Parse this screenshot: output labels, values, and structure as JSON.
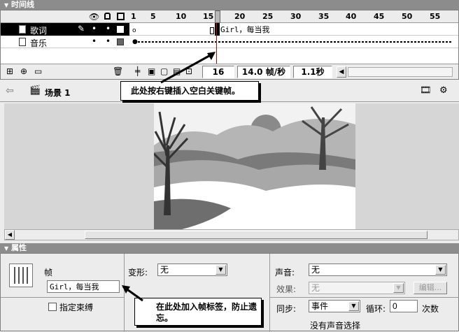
{
  "timeline": {
    "title": "时间线",
    "ruler": [
      "1",
      "5",
      "10",
      "15",
      "20",
      "25",
      "30",
      "35",
      "40",
      "45",
      "50",
      "55"
    ],
    "layers": [
      {
        "name": "歌词",
        "selected": true
      },
      {
        "name": "音乐",
        "selected": false
      }
    ],
    "frame_label": "Girl，每当我",
    "status": {
      "frame": "16",
      "fps": "14.0 帧/秒",
      "time": "1.1秒"
    }
  },
  "stage": {
    "scene": "场景 1"
  },
  "callout1": "此处按右键插入空白关键帧。",
  "callout2": "在此处加入帧标签，防止遗忘。",
  "properties": {
    "title": "属性",
    "frame_heading": "帧",
    "frame_label_value": "Girl，每当我",
    "checkbox_label": "指定束缚",
    "tween_label": "变形:",
    "tween_value": "无",
    "sound_label": "声音:",
    "sound_value": "无",
    "effect_label": "效果:",
    "effect_value": "无",
    "edit_button": "编辑...",
    "sync_label": "同步:",
    "sync_value": "事件",
    "loop_label": "循环:",
    "loop_value": "0",
    "loop_unit": "次数",
    "no_sound": "没有声音选择"
  },
  "colors": {
    "panel_header": "#8c8c8c",
    "selected_layer": "#000000",
    "playhead": "#cc0000"
  }
}
